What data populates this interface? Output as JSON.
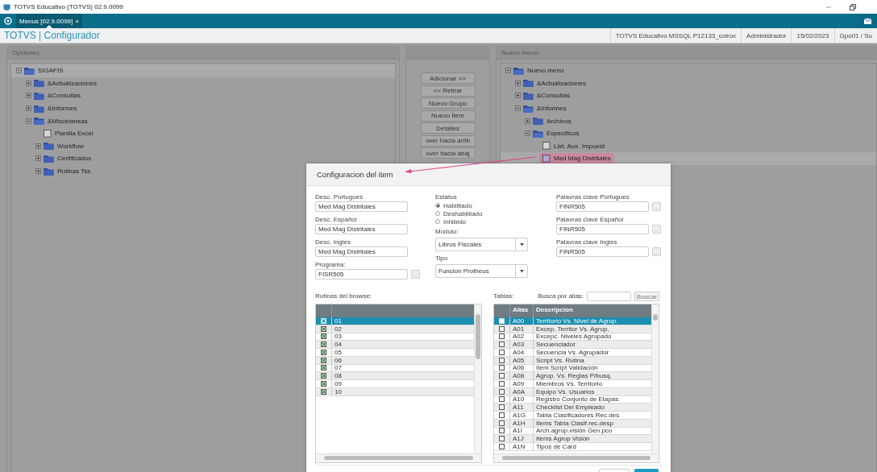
{
  "window": {
    "title": "TOTVS Educativo (TOTVS) 02.9.0099"
  },
  "tabs": [
    {
      "label": "Menus [02.9.0099]",
      "close": "×",
      "selected": true
    }
  ],
  "header": {
    "title": "TOTVS | Configurador",
    "status": [
      "TOTVS Educativo MSSQL P12133_colrox",
      "Administrador",
      "15/02/2023",
      "Gpo01 / Su"
    ]
  },
  "left_panel": {
    "title": "Opciones:",
    "tree": [
      {
        "label": "SIGAFIS",
        "kind": "folder",
        "expanded": true,
        "selected": true,
        "children": [
          {
            "label": "&Actualizaciones",
            "kind": "folder",
            "expanded": false,
            "selected": false
          },
          {
            "label": "&Consultas",
            "kind": "folder",
            "expanded": false,
            "selected": false
          },
          {
            "label": "&Informes",
            "kind": "folder",
            "expanded": false,
            "selected": false
          },
          {
            "label": "&Miscelaneas",
            "kind": "folder",
            "expanded": true,
            "selected": false,
            "children": [
              {
                "label": "Planilla Excel",
                "kind": "item",
                "selected": false
              },
              {
                "label": "Workflow",
                "kind": "folder",
                "expanded": false,
                "selected": false
              },
              {
                "label": "Certificados",
                "kind": "folder",
                "expanded": false,
                "selected": false
              },
              {
                "label": "Rutinas Tss",
                "kind": "folder",
                "expanded": false,
                "selected": false
              }
            ]
          }
        ]
      }
    ]
  },
  "middle_buttons": [
    "Adicionar >>",
    "<< Retirar",
    "Nuevo Grupo",
    "Nuevo Ítem",
    "Detalles",
    "over hacia arrib",
    "over hacia abaj"
  ],
  "right_panel": {
    "title": "Nuevo menu:",
    "tree": [
      {
        "label": "Nuevo menu",
        "kind": "folder",
        "expanded": true,
        "selected": false,
        "children": [
          {
            "label": "&Actualizaciones",
            "kind": "folder",
            "expanded": false,
            "selected": false
          },
          {
            "label": "&Consultas",
            "kind": "folder",
            "expanded": false,
            "selected": false
          },
          {
            "label": "&Informes",
            "kind": "folder",
            "expanded": true,
            "selected": false,
            "children": [
              {
                "label": "Archivos",
                "kind": "folder",
                "expanded": false,
                "selected": false
              },
              {
                "label": "Especificos",
                "kind": "folder",
                "expanded": true,
                "selected": false,
                "children": [
                  {
                    "label": "List. Aux. Impuest",
                    "kind": "item",
                    "selected": false
                  },
                  {
                    "label": "Med Mag Distritales",
                    "kind": "item",
                    "selected": true
                  }
                ]
              }
            ]
          }
        ]
      }
    ]
  },
  "dialog": {
    "title": "Configuracion del item",
    "fields": [
      {
        "label": "Desc. Portugues",
        "value": "Med Mag Distritales"
      },
      {
        "label": "Desc. Español",
        "value": "Med Mag Distritales"
      },
      {
        "label": "Desc. Ingles",
        "value": "Med Mag Distritales"
      },
      {
        "label": "Programa:",
        "value": "FISR505",
        "button": "..."
      }
    ],
    "estatus": {
      "label": "Estatus",
      "options": [
        {
          "label": "Habilitado",
          "selected": true
        },
        {
          "label": "Deshabilitado",
          "selected": false
        },
        {
          "label": "Inhibido",
          "selected": false
        }
      ]
    },
    "selects": [
      {
        "label": "Modulo:",
        "value": "Libros Fiscales"
      },
      {
        "label": "Tipo",
        "value": "Funcion Protheus"
      }
    ],
    "keywords": [
      {
        "label": "Palavras clave Portugues",
        "value": "FINR505",
        "button": "..."
      },
      {
        "label": "Palavras clave Español",
        "value": "FINR505",
        "button": "..."
      },
      {
        "label": "Palavras clave Ingles",
        "value": "FINR505",
        "button": "..."
      }
    ],
    "browse": {
      "label": "Rutinas del browse:",
      "rows": [
        {
          "code": "01",
          "checked": true,
          "selected": true
        },
        {
          "code": "02",
          "checked": true,
          "selected": false
        },
        {
          "code": "03",
          "checked": true,
          "selected": false
        },
        {
          "code": "04",
          "checked": true,
          "selected": false
        },
        {
          "code": "05",
          "checked": true,
          "selected": false
        },
        {
          "code": "06",
          "checked": true,
          "selected": false
        },
        {
          "code": "07",
          "checked": true,
          "selected": false
        },
        {
          "code": "08",
          "checked": true,
          "selected": false
        },
        {
          "code": "09",
          "checked": true,
          "selected": false
        },
        {
          "code": "10",
          "checked": true,
          "selected": false
        }
      ]
    },
    "tables": {
      "label": "Tablas:",
      "search_label": "Busca por alias:",
      "search_button": "Buscar",
      "columns": [
        "Alias",
        "Descripcion"
      ],
      "rows": [
        {
          "alias": "A00",
          "description": "Territorio Vs. Nivel de Agrup.",
          "checked": false,
          "selected": true
        },
        {
          "alias": "A01",
          "description": "Excep. Territor Vs. Agrup.",
          "checked": false,
          "selected": false
        },
        {
          "alias": "A02",
          "description": "Excepc. Niveles Agrupado",
          "checked": false,
          "selected": false
        },
        {
          "alias": "A03",
          "description": "Secuenciador",
          "checked": false,
          "selected": false
        },
        {
          "alias": "A04",
          "description": "Secuencia Vs. Agrupador",
          "checked": false,
          "selected": false
        },
        {
          "alias": "A05",
          "description": "Script Vs. Rutina",
          "checked": false,
          "selected": false
        },
        {
          "alias": "A06",
          "description": "Item Script Validación",
          "checked": false,
          "selected": false
        },
        {
          "alias": "A08",
          "description": "Agrup. Vs. Reglas P/busq.",
          "checked": false,
          "selected": false
        },
        {
          "alias": "A09",
          "description": "Miembros Vs. Territorio",
          "checked": false,
          "selected": false
        },
        {
          "alias": "A0A",
          "description": "Equipo Vs. Usuarios",
          "checked": false,
          "selected": false
        },
        {
          "alias": "A10",
          "description": "Registro Conjunto de Etapas",
          "checked": false,
          "selected": false
        },
        {
          "alias": "A11",
          "description": "Checklist Del Empleado",
          "checked": false,
          "selected": false
        },
        {
          "alias": "A1G",
          "description": "Tabla Clasificadores Rec.des",
          "checked": false,
          "selected": false
        },
        {
          "alias": "A1H",
          "description": "Items Tabla Clasif.rec.desp",
          "checked": false,
          "selected": false
        },
        {
          "alias": "A1I",
          "description": "Arch.agrup.visión Gen.pco",
          "checked": false,
          "selected": false
        },
        {
          "alias": "A1J",
          "description": "Items Agrup Visión",
          "checked": false,
          "selected": false
        },
        {
          "alias": "A1N",
          "description": "Tipos de Card",
          "checked": false,
          "selected": false
        }
      ]
    }
  }
}
